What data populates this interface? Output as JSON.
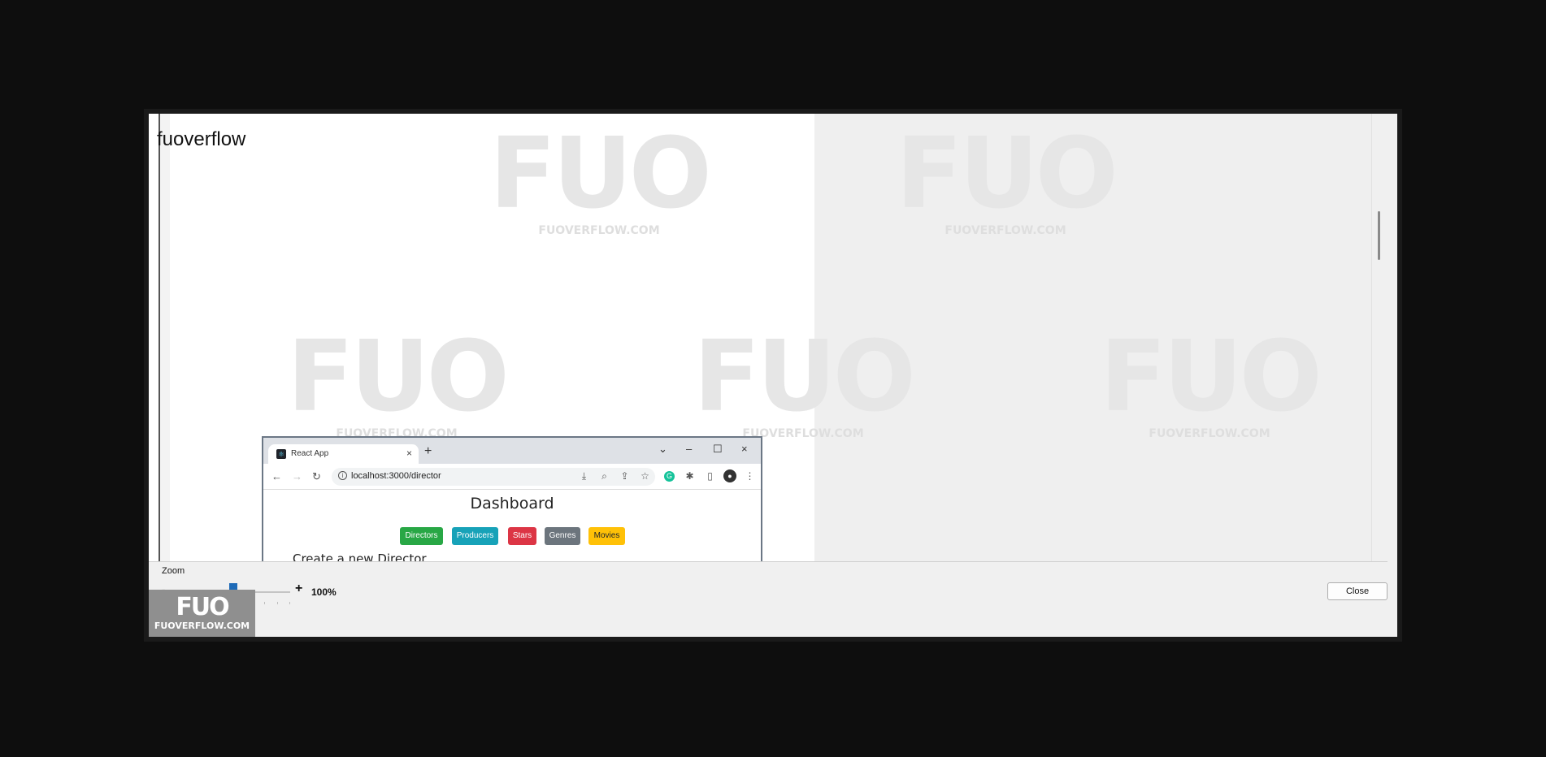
{
  "site_title": "fuoverflow",
  "watermark": {
    "mark": "FUO",
    "domain": "FUOVERFLOW.COM"
  },
  "logo": {
    "mark": "FUO",
    "domain": "FUOVERFLOW.COM"
  },
  "embedded_browser": {
    "tab_title": "React App",
    "tab_close": "×",
    "new_tab": "+",
    "window_controls": {
      "dropdown": "⌄",
      "minimize": "–",
      "maximize": "☐",
      "close": "×"
    },
    "url": "localhost:3000/director",
    "page_heading": "Dashboard",
    "buttons": [
      {
        "label": "Directors",
        "color": "#28a745"
      },
      {
        "label": "Producers",
        "color": "#17a2b8"
      },
      {
        "label": "Stars",
        "color": "#dc3545"
      },
      {
        "label": "Genres",
        "color": "#6c757d"
      },
      {
        "label": "Movies",
        "color": "#ffc107"
      }
    ],
    "section_heading": "Create a new Director"
  },
  "zoom": {
    "label": "Zoom",
    "minus": "-",
    "plus": "+",
    "value": "100%",
    "level_fraction": 0.5
  },
  "close_button": "Close"
}
